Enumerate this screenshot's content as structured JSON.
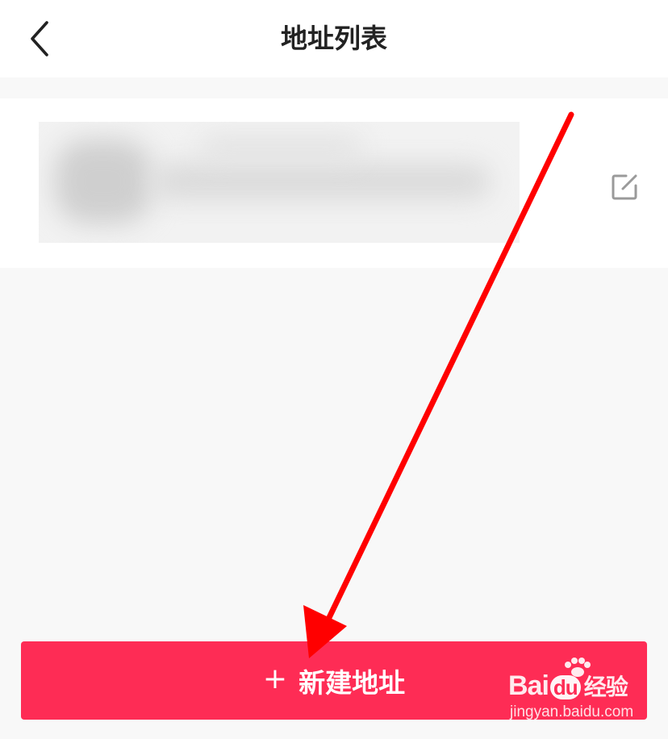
{
  "header": {
    "title": "地址列表",
    "back_icon": "chevron-left-icon"
  },
  "address_card": {
    "edit_icon": "edit-icon"
  },
  "footer": {
    "new_button_label": "新建地址",
    "plus_symbol": "+",
    "accent_color": "#fe2c55"
  },
  "watermark": {
    "logo_bai": "Bai",
    "logo_du": "du",
    "logo_suffix": "经验",
    "url": "jingyan.baidu.com"
  },
  "annotation": {
    "arrow_color": "#ff0000"
  }
}
